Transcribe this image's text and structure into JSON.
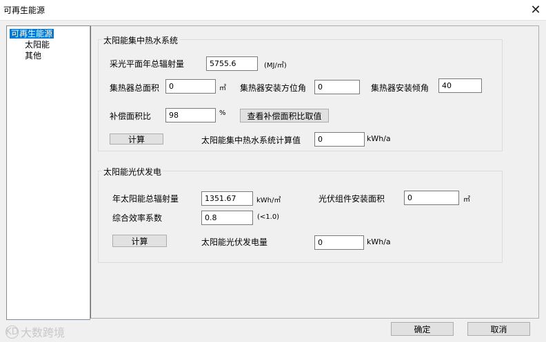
{
  "window": {
    "title": "可再生能源",
    "close_icon": "close-icon"
  },
  "tree": {
    "items": [
      "可再生能源",
      "太阳能",
      "其他"
    ],
    "selected": "可再生能源"
  },
  "solar_thermal": {
    "title": "太阳能集中热水系统",
    "annual_radiation_label": "采光平面年总辐射量",
    "annual_radiation_value": "5755.6",
    "annual_radiation_unit": "(MJ/㎡)",
    "collector_area_label": "集热器总面积",
    "collector_area_value": "0",
    "collector_area_unit": "㎡",
    "azimuth_label": "集热器安装方位角",
    "azimuth_value": "0",
    "tilt_label": "集热器安装倾角",
    "tilt_value": "40",
    "compensation_label": "补偿面积比",
    "compensation_value": "98",
    "compensation_unit": "%",
    "view_compensation_button": "查看补偿面积比取值",
    "calc_button": "计算",
    "result_label": "太阳能集中热水系统计算值",
    "result_value": "0",
    "result_unit": "kWh/a"
  },
  "solar_pv": {
    "title": "太阳能光伏发电",
    "annual_radiation_label": "年太阳能总辐射量",
    "annual_radiation_value": "1351.67",
    "annual_radiation_unit": "kWh/㎡",
    "module_area_label": "光伏组件安装面积",
    "module_area_value": "0",
    "module_area_unit": "㎡",
    "efficiency_label": "综合效率系数",
    "efficiency_value": "0.8",
    "efficiency_hint": "(<1.0)",
    "calc_button": "计算",
    "result_label": "太阳能光伏发电量",
    "result_value": "0",
    "result_unit": "kWh/a"
  },
  "footer": {
    "ok_button": "确定",
    "cancel_button": "取消",
    "watermark": "大数跨境",
    "watermark_logo": "KD"
  }
}
